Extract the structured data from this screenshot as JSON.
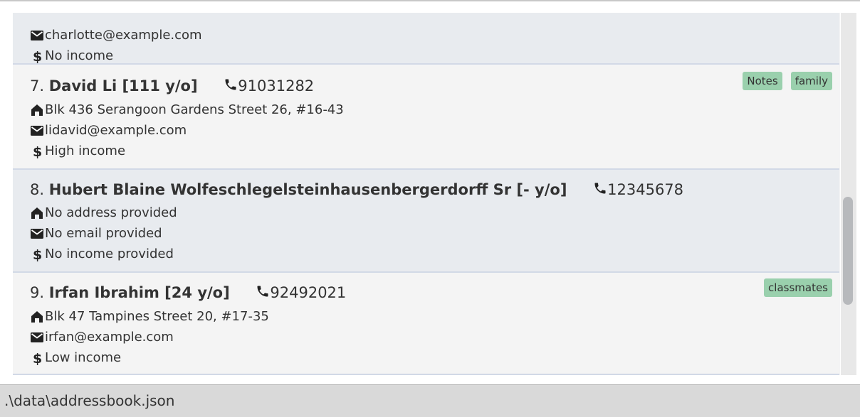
{
  "persons": [
    {
      "index": "",
      "name": "",
      "phone": "",
      "address": "",
      "email": "charlotte@example.com",
      "income": "No income",
      "tags": []
    },
    {
      "index": "7.",
      "name": "David Li [111 y/o]",
      "phone": "91031282",
      "address": "Blk 436 Serangoon Gardens Street 26, #16-43",
      "email": "lidavid@example.com",
      "income": "High income",
      "tags": [
        "Notes",
        "family"
      ]
    },
    {
      "index": "8.",
      "name": "Hubert Blaine Wolfeschlegelsteinhausenbergerdorff Sr [- y/o]",
      "phone": "12345678",
      "address": "No address provided",
      "email": "No email provided",
      "income": "No income provided",
      "tags": []
    },
    {
      "index": "9.",
      "name": "Irfan Ibrahim [24 y/o]",
      "phone": "92492021",
      "address": "Blk 47 Tampines Street 20, #17-35",
      "email": "irfan@example.com",
      "income": "Low income",
      "tags": [
        "classmates"
      ]
    }
  ],
  "statusbar": {
    "path": ".\\data\\addressbook.json"
  },
  "colors": {
    "tag_bg": "#9ad0ad",
    "card_even": "#e8ebef",
    "card_odd": "#f4f4f4",
    "scroll_thumb": "#b7b9bc"
  },
  "icons": {
    "phone": "phone-icon",
    "address": "home-icon",
    "email": "mail-icon",
    "income": "dollar-icon"
  }
}
